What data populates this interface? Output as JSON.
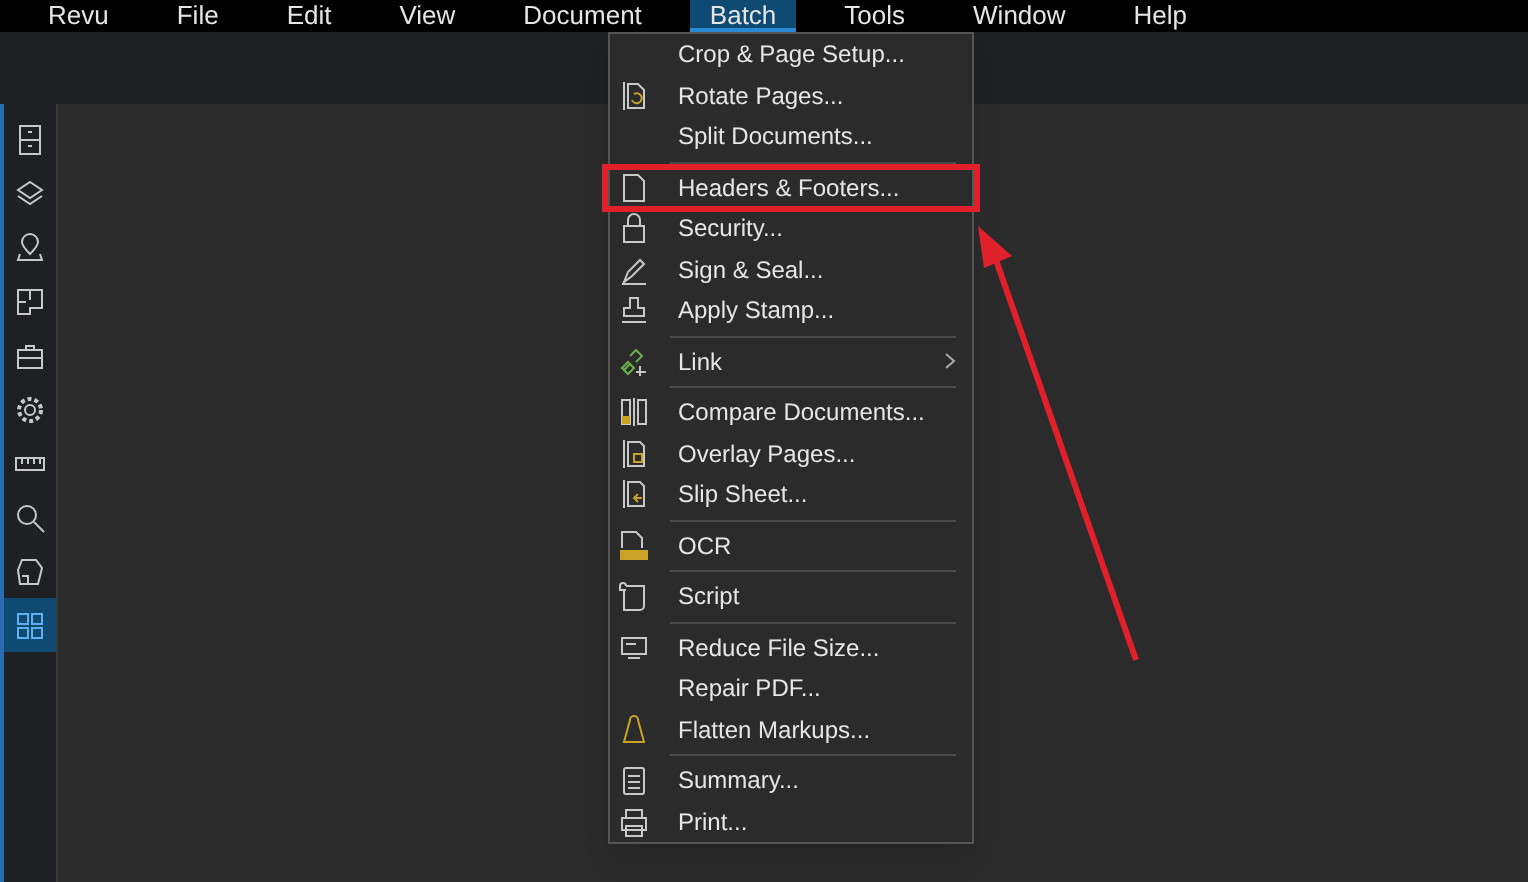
{
  "menu_bar": [
    {
      "label": "Revu",
      "selected": false
    },
    {
      "label": "File",
      "selected": false
    },
    {
      "label": "Edit",
      "selected": false
    },
    {
      "label": "View",
      "selected": false
    },
    {
      "label": "Document",
      "selected": false
    },
    {
      "label": "Batch",
      "selected": true
    },
    {
      "label": "Tools",
      "selected": false
    },
    {
      "label": "Window",
      "selected": false
    },
    {
      "label": "Help",
      "selected": false
    }
  ],
  "sidebar": [
    {
      "selected": false
    },
    {
      "selected": false
    },
    {
      "selected": false
    },
    {
      "selected": false
    },
    {
      "selected": false
    },
    {
      "selected": false
    },
    {
      "selected": false
    },
    {
      "selected": false
    },
    {
      "selected": false
    },
    {
      "selected": true
    }
  ],
  "batch_menu": [
    {
      "kind": "item",
      "label": "Crop & Page Setup..."
    },
    {
      "kind": "item",
      "label": "Rotate Pages..."
    },
    {
      "kind": "item",
      "label": "Split Documents..."
    },
    {
      "kind": "separator"
    },
    {
      "kind": "item",
      "label": "Headers & Footers...",
      "highlighted": true
    },
    {
      "kind": "item",
      "label": "Security..."
    },
    {
      "kind": "item",
      "label": "Sign & Seal..."
    },
    {
      "kind": "item",
      "label": "Apply Stamp..."
    },
    {
      "kind": "separator"
    },
    {
      "kind": "submenu",
      "label": "Link"
    },
    {
      "kind": "separator"
    },
    {
      "kind": "item",
      "label": "Compare Documents..."
    },
    {
      "kind": "item",
      "label": "Overlay Pages..."
    },
    {
      "kind": "item",
      "label": "Slip Sheet..."
    },
    {
      "kind": "separator"
    },
    {
      "kind": "item",
      "label": "OCR"
    },
    {
      "kind": "separator"
    },
    {
      "kind": "item",
      "label": "Script"
    },
    {
      "kind": "separator"
    },
    {
      "kind": "item",
      "label": "Reduce File Size..."
    },
    {
      "kind": "item",
      "label": "Repair PDF..."
    },
    {
      "kind": "item",
      "label": "Flatten Markups..."
    },
    {
      "kind": "separator"
    },
    {
      "kind": "item",
      "label": "Summary..."
    },
    {
      "kind": "item",
      "label": "Print..."
    }
  ]
}
